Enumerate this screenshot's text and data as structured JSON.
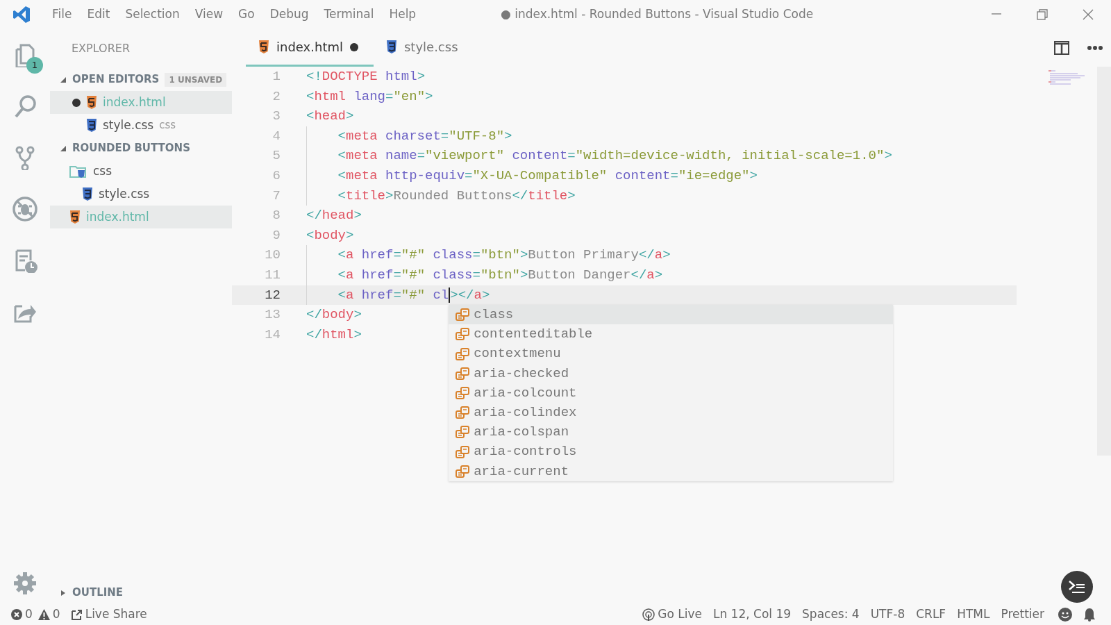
{
  "title_bar": {
    "menu": [
      "File",
      "Edit",
      "Selection",
      "View",
      "Go",
      "Debug",
      "Terminal",
      "Help"
    ],
    "title": "● index.html - Rounded Buttons - Visual Studio Code"
  },
  "activity_bar": [
    {
      "kind": "explorer",
      "badge": "1"
    },
    {
      "kind": "search"
    },
    {
      "kind": "scm"
    },
    {
      "kind": "debug"
    },
    {
      "kind": "history"
    },
    {
      "kind": "share"
    },
    {
      "kind": "settings"
    }
  ],
  "sidebar": {
    "title": "EXPLORER",
    "sections": [
      {
        "title": "OPEN EDITORS",
        "badge": "1 UNSAVED",
        "expanded": true,
        "items": [
          {
            "name": "index.html",
            "kind": "html",
            "unsaved": true,
            "selected": true
          },
          {
            "name": "style.css",
            "kind": "css",
            "description": "css",
            "unsaved": false,
            "selected": false
          }
        ]
      },
      {
        "title": "ROUNDED BUTTONS",
        "expanded": true,
        "items": [
          {
            "name": "css",
            "kind": "folder",
            "selected": false,
            "children": [
              {
                "name": "style.css",
                "kind": "css",
                "selected": false
              }
            ]
          },
          {
            "name": "index.html",
            "kind": "html",
            "selected": true
          }
        ]
      },
      {
        "title": "OUTLINE",
        "expanded": false
      }
    ]
  },
  "tabs": [
    {
      "label": "index.html",
      "kind": "html",
      "selected": true,
      "unsaved": true
    },
    {
      "label": "style.css",
      "kind": "css",
      "selected": false,
      "unsaved": false
    }
  ],
  "editor": {
    "lines": [
      {
        "number": "1",
        "current": false,
        "tokens": [
          {
            "kind": "punct",
            "text": "<!"
          },
          {
            "kind": "tag",
            "text": "DOCTYPE"
          },
          {
            "kind": "attr",
            "text": " html"
          },
          {
            "kind": "punct",
            "text": ">"
          }
        ]
      },
      {
        "number": "2",
        "current": false,
        "tokens": [
          {
            "kind": "punct",
            "text": "<"
          },
          {
            "kind": "tag",
            "text": "html"
          },
          {
            "kind": "attr",
            "text": " lang"
          },
          {
            "kind": "punct",
            "text": "="
          },
          {
            "kind": "string",
            "text": "\"en\""
          },
          {
            "kind": "punct",
            "text": ">"
          }
        ]
      },
      {
        "number": "3",
        "current": false,
        "tokens": [
          {
            "kind": "punct",
            "text": "<"
          },
          {
            "kind": "tag",
            "text": "head"
          },
          {
            "kind": "punct",
            "text": ">"
          }
        ],
        "children": [
          {
            "number": "4",
            "current": false,
            "tokens": [
              {
                "kind": "punct",
                "text": "<"
              },
              {
                "kind": "tag",
                "text": "meta"
              },
              {
                "kind": "attr",
                "text": " charset"
              },
              {
                "kind": "punct",
                "text": "="
              },
              {
                "kind": "string",
                "text": "\"UTF-8\""
              },
              {
                "kind": "punct",
                "text": ">"
              }
            ]
          },
          {
            "number": "5",
            "current": false,
            "tokens": [
              {
                "kind": "punct",
                "text": "<"
              },
              {
                "kind": "tag",
                "text": "meta"
              },
              {
                "kind": "attr",
                "text": " name"
              },
              {
                "kind": "punct",
                "text": "="
              },
              {
                "kind": "string",
                "text": "\"viewport\""
              },
              {
                "kind": "attr",
                "text": " content"
              },
              {
                "kind": "punct",
                "text": "="
              },
              {
                "kind": "string",
                "text": "\"width=device-width, initial-scale=1.0\""
              },
              {
                "kind": "punct",
                "text": ">"
              }
            ]
          },
          {
            "number": "6",
            "current": false,
            "tokens": [
              {
                "kind": "punct",
                "text": "<"
              },
              {
                "kind": "tag",
                "text": "meta"
              },
              {
                "kind": "attr",
                "text": " http-equiv"
              },
              {
                "kind": "punct",
                "text": "="
              },
              {
                "kind": "string",
                "text": "\"X-UA-Compatible\""
              },
              {
                "kind": "attr",
                "text": " content"
              },
              {
                "kind": "punct",
                "text": "="
              },
              {
                "kind": "string",
                "text": "\"ie=edge\""
              },
              {
                "kind": "punct",
                "text": ">"
              }
            ]
          },
          {
            "number": "7",
            "current": false,
            "tokens": [
              {
                "kind": "punct",
                "text": "<"
              },
              {
                "kind": "tag",
                "text": "title"
              },
              {
                "kind": "punct",
                "text": ">"
              },
              {
                "kind": "text",
                "text": "Rounded Buttons"
              },
              {
                "kind": "punct",
                "text": "</"
              },
              {
                "kind": "tag",
                "text": "title"
              },
              {
                "kind": "punct",
                "text": ">"
              }
            ]
          }
        ]
      },
      {
        "number": "8",
        "current": false,
        "tokens": [
          {
            "kind": "punct",
            "text": "</"
          },
          {
            "kind": "tag",
            "text": "head"
          },
          {
            "kind": "punct",
            "text": ">"
          }
        ]
      },
      {
        "number": "9",
        "current": false,
        "tokens": [
          {
            "kind": "punct",
            "text": "<"
          },
          {
            "kind": "tag",
            "text": "body"
          },
          {
            "kind": "punct",
            "text": ">"
          }
        ],
        "children": [
          {
            "number": "10",
            "current": false,
            "tokens": [
              {
                "kind": "punct",
                "text": "<"
              },
              {
                "kind": "tag",
                "text": "a"
              },
              {
                "kind": "attr",
                "text": " href"
              },
              {
                "kind": "punct",
                "text": "="
              },
              {
                "kind": "string",
                "text": "\"#\""
              },
              {
                "kind": "attr",
                "text": " class"
              },
              {
                "kind": "punct",
                "text": "="
              },
              {
                "kind": "string",
                "text": "\"btn\""
              },
              {
                "kind": "punct",
                "text": ">"
              },
              {
                "kind": "text",
                "text": "Button Primary"
              },
              {
                "kind": "punct",
                "text": "</"
              },
              {
                "kind": "tag",
                "text": "a"
              },
              {
                "kind": "punct",
                "text": ">"
              }
            ]
          },
          {
            "number": "11",
            "current": false,
            "tokens": [
              {
                "kind": "punct",
                "text": "<"
              },
              {
                "kind": "tag",
                "text": "a"
              },
              {
                "kind": "attr",
                "text": " href"
              },
              {
                "kind": "punct",
                "text": "="
              },
              {
                "kind": "string",
                "text": "\"#\""
              },
              {
                "kind": "attr",
                "text": " class"
              },
              {
                "kind": "punct",
                "text": "="
              },
              {
                "kind": "string",
                "text": "\"btn\""
              },
              {
                "kind": "punct",
                "text": ">"
              },
              {
                "kind": "text",
                "text": "Button Danger"
              },
              {
                "kind": "punct",
                "text": "</"
              },
              {
                "kind": "tag",
                "text": "a"
              },
              {
                "kind": "punct",
                "text": ">"
              }
            ]
          },
          {
            "number": "12",
            "current": true,
            "tokens": [
              {
                "kind": "punct",
                "text": "<"
              },
              {
                "kind": "tag",
                "text": "a"
              },
              {
                "kind": "attr",
                "text": " href"
              },
              {
                "kind": "punct",
                "text": "="
              },
              {
                "kind": "string",
                "text": "\"#\""
              },
              {
                "kind": "attr",
                "text": " cl",
                "cursor_after": true
              },
              {
                "kind": "punct",
                "text": "></"
              },
              {
                "kind": "tag",
                "text": "a"
              },
              {
                "kind": "punct",
                "text": ">"
              }
            ]
          }
        ]
      },
      {
        "number": "13",
        "current": false,
        "tokens": [
          {
            "kind": "punct",
            "text": "</"
          },
          {
            "kind": "tag",
            "text": "body"
          },
          {
            "kind": "punct",
            "text": ">"
          }
        ]
      },
      {
        "number": "14",
        "current": false,
        "tokens": [
          {
            "kind": "punct",
            "text": "</"
          },
          {
            "kind": "tag",
            "text": "html"
          },
          {
            "kind": "punct",
            "text": ">"
          }
        ]
      }
    ]
  },
  "suggestions": [
    {
      "label": "class",
      "selected": true
    },
    {
      "label": "contenteditable",
      "selected": false
    },
    {
      "label": "contextmenu",
      "selected": false
    },
    {
      "label": "aria-checked",
      "selected": false
    },
    {
      "label": "aria-colcount",
      "selected": false
    },
    {
      "label": "aria-colindex",
      "selected": false
    },
    {
      "label": "aria-colspan",
      "selected": false
    },
    {
      "label": "aria-controls",
      "selected": false
    },
    {
      "label": "aria-current",
      "selected": false
    }
  ],
  "status_bar": {
    "errors": "0",
    "warnings": "0",
    "left": [
      "Live Share"
    ],
    "right": [
      {
        "kind": "golive",
        "text": "Go Live"
      },
      {
        "kind": "text",
        "text": "Ln 12, Col 19"
      },
      {
        "kind": "text",
        "text": "Spaces: 4"
      },
      {
        "kind": "text",
        "text": "UTF-8"
      },
      {
        "kind": "text",
        "text": "CRLF"
      },
      {
        "kind": "text",
        "text": "HTML"
      },
      {
        "kind": "text",
        "text": "Prettier"
      },
      {
        "kind": "smiley"
      },
      {
        "kind": "bell"
      }
    ]
  }
}
